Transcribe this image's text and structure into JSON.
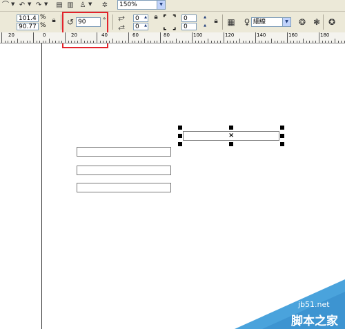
{
  "toolbar": {
    "zoom": "150%",
    "size_width": "101.4",
    "size_height": "90.77",
    "rotation": "90",
    "rotation_unit": "°",
    "percent_sign": "%",
    "field_a1": "0",
    "field_a2": "0",
    "field_b1": "0",
    "field_b2": "0",
    "outline_width": "細線"
  },
  "ruler": {
    "labels": [
      "20",
      "0",
      "20",
      "40",
      "60",
      "80",
      "100",
      "120",
      "140",
      "160",
      "180"
    ]
  },
  "watermark": {
    "site": "jb51.net",
    "brand": "脚本之家"
  },
  "colors": {
    "highlight": "#e3232b",
    "watermark": "#4aa3dc"
  }
}
